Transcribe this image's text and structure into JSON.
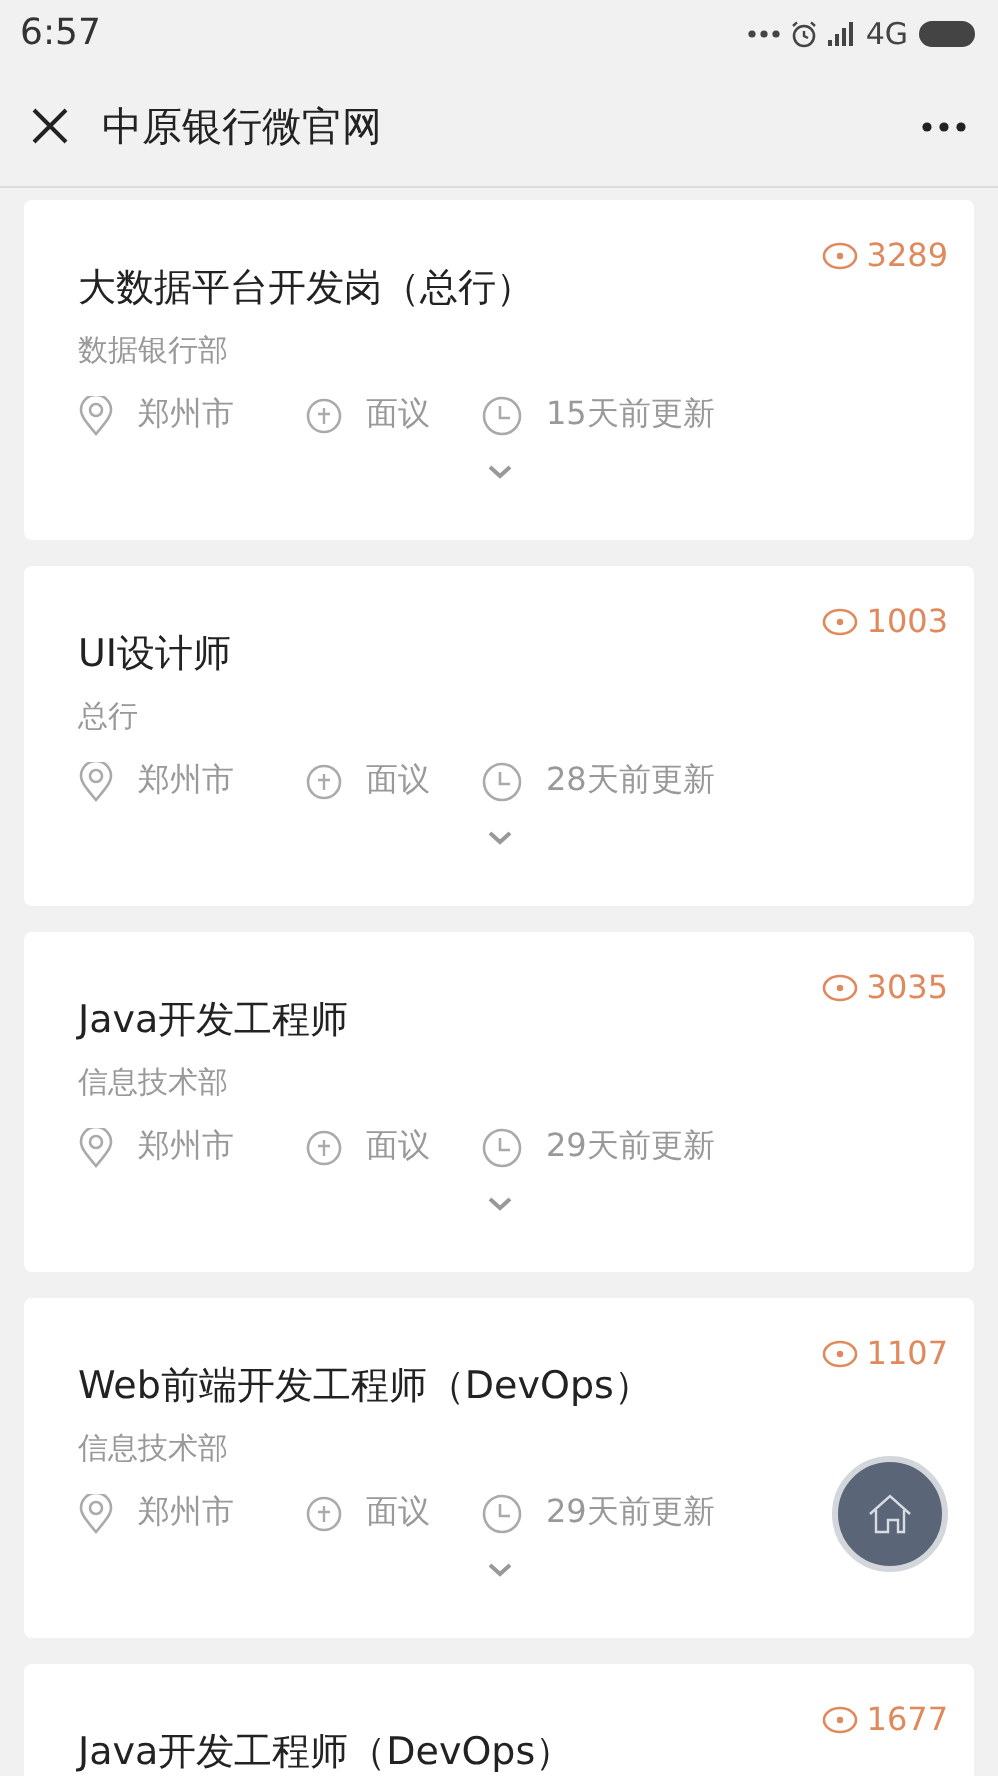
{
  "status_bar": {
    "time": "6:57",
    "network": "4G"
  },
  "header": {
    "title": "中原银行微官网"
  },
  "jobs": [
    {
      "title": "大数据平台开发岗（总行）",
      "department": "数据银行部",
      "views": "3289",
      "city": "郑州市",
      "salary": "面议",
      "updated": "15天前更新"
    },
    {
      "title": "UI设计师",
      "department": "总行",
      "views": "1003",
      "city": "郑州市",
      "salary": "面议",
      "updated": "28天前更新"
    },
    {
      "title": "Java开发工程师",
      "department": "信息技术部",
      "views": "3035",
      "city": "郑州市",
      "salary": "面议",
      "updated": "29天前更新"
    },
    {
      "title": "Web前端开发工程师（DevOps）",
      "department": "信息技术部",
      "views": "1107",
      "city": "郑州市",
      "salary": "面议",
      "updated": "29天前更新"
    },
    {
      "title": "Java开发工程师（DevOps）",
      "views": "1677"
    }
  ]
}
